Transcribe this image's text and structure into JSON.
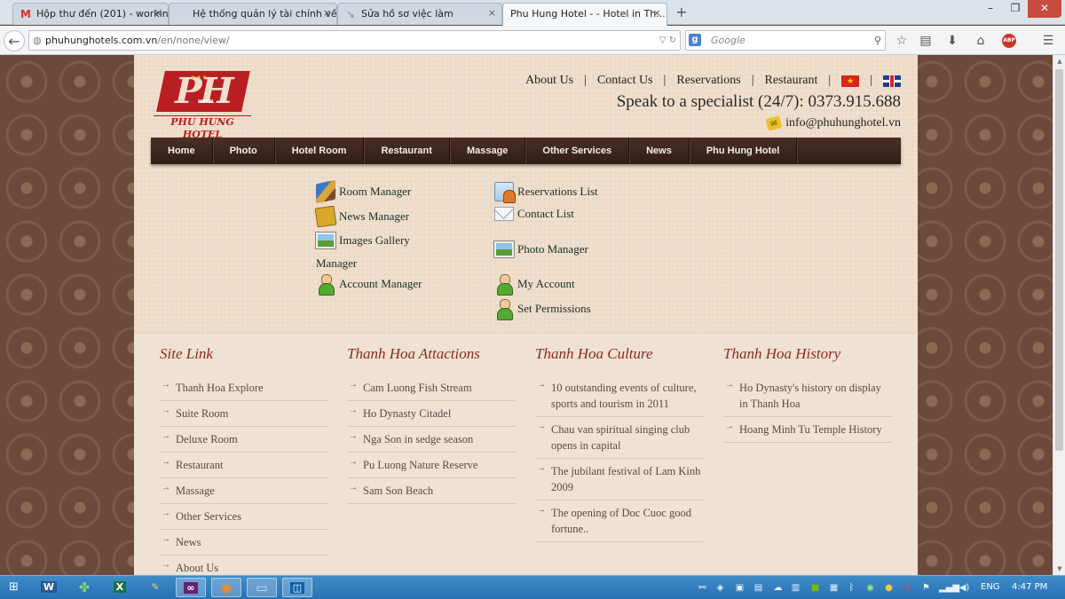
{
  "browser": {
    "tabs": [
      {
        "title": "Hộp thư đến (201) - workin...",
        "favicon": "gmail-icon",
        "glyph": "M",
        "color": "#d93025"
      },
      {
        "title": "Hệ thống quản lý tài chính về ...",
        "favicon": "page-icon",
        "glyph": "",
        "color": "#888"
      },
      {
        "title": "Sửa hồ sơ việc làm",
        "favicon": "arrow-icon",
        "glyph": "↘",
        "color": "#6f8fb0"
      },
      {
        "title": "Phu Hung Hotel - - Hotel in Th...",
        "favicon": "page-icon",
        "glyph": "",
        "color": "#888"
      }
    ],
    "tab_close": "×",
    "new_tab": "+",
    "url_host": "phuhunghotels.com.vn",
    "url_path": "/en/none/view/",
    "search_engine": "g",
    "search_placeholder": "Google",
    "abp": "ABP"
  },
  "site": {
    "logo": {
      "mark": "PH",
      "stars": "★★★",
      "sub": "HOTEL",
      "name": "PHU HUNG HOTEL"
    },
    "topnav": [
      "About Us",
      "Contact Us",
      "Reservations",
      "Restaurant"
    ],
    "separator": "|",
    "speak": "Speak to a specialist (24/7): 0373.915.688",
    "email": "info@phuhunghotel.vn",
    "mainnav": [
      "Home",
      "Photo",
      "Hotel Room",
      "Restaurant",
      "Massage",
      "Other Services",
      "News",
      "Phu Hung Hotel"
    ],
    "admin_left": [
      {
        "label": "Room Manager",
        "icon": "room-manager-icon"
      },
      {
        "label": "News Manager",
        "icon": "news-manager-icon"
      },
      {
        "label": "Images Gallery",
        "label2": "Manager",
        "icon": "images-gallery-icon"
      },
      {
        "label": "Account Manager",
        "icon": "account-manager-icon"
      }
    ],
    "admin_right": [
      {
        "label": "Reservations List",
        "icon": "reservations-icon"
      },
      {
        "label": "Contact List",
        "icon": "contact-list-icon"
      },
      {
        "label": "Photo Manager",
        "icon": "photo-manager-icon"
      },
      {
        "label": "My Account",
        "icon": "my-account-icon"
      },
      {
        "label": "Set Permissions",
        "icon": "set-permissions-icon"
      }
    ],
    "footer": [
      {
        "title": "Site Link",
        "items": [
          "Thanh Hoa Explore",
          "Suite Room",
          "Deluxe Room",
          "Restaurant",
          "Massage",
          "Other Services",
          "News",
          "About Us"
        ]
      },
      {
        "title": "Thanh Hoa Attactions",
        "items": [
          "Cam Luong Fish Stream",
          "Ho Dynasty Citadel",
          "Nga Son in sedge season",
          "Pu Luong Nature Reserve",
          "Sam Son Beach"
        ]
      },
      {
        "title": "Thanh Hoa Culture",
        "items": [
          "10 outstanding events of culture, sports and tourism in 2011",
          "Chau van spiritual singing club opens in capital",
          "The jubilant festival of Lam Kinh 2009",
          "The opening of Doc Cuoc good fortune.."
        ]
      },
      {
        "title": "Thanh Hoa History",
        "items": [
          "Ho Dynasty's history on display in Thanh Hoa",
          "Hoang Minh Tu Temple History"
        ]
      }
    ],
    "footer_arrow": "→"
  },
  "taskbar": {
    "apps": [
      {
        "name": "word-taskbar-icon",
        "glyph": "W",
        "color": "#2b5797",
        "active": false
      },
      {
        "name": "clover-taskbar-icon",
        "glyph": "✤",
        "color": "#4aa83a",
        "active": false
      },
      {
        "name": "excel-taskbar-icon",
        "glyph": "X",
        "color": "#1e7145",
        "active": false
      },
      {
        "name": "tool-taskbar-icon",
        "glyph": "✎",
        "color": "#d9b23a",
        "active": false
      },
      {
        "name": "visual-studio-taskbar-icon",
        "glyph": "∞",
        "color": "#68217a",
        "active": true
      },
      {
        "name": "firefox-taskbar-icon",
        "glyph": "◉",
        "color": "#e66000",
        "active": true
      },
      {
        "name": "remote-taskbar-icon",
        "glyph": "▭",
        "color": "#6b8fb0",
        "active": true
      },
      {
        "name": "outlook-taskbar-icon",
        "glyph": "◫",
        "color": "#0a64ad",
        "active": true
      }
    ],
    "lang": "ENG",
    "time": "4:47 PM"
  }
}
